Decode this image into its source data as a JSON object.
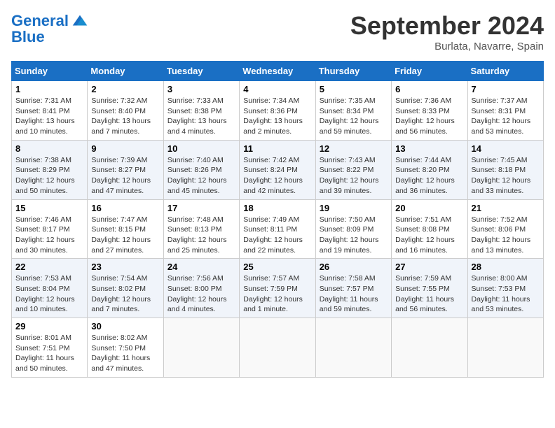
{
  "header": {
    "logo_line1": "General",
    "logo_line2": "Blue",
    "month_title": "September 2024",
    "location": "Burlata, Navarre, Spain"
  },
  "days_of_week": [
    "Sunday",
    "Monday",
    "Tuesday",
    "Wednesday",
    "Thursday",
    "Friday",
    "Saturday"
  ],
  "weeks": [
    [
      {
        "day": 1,
        "sunrise": "7:31 AM",
        "sunset": "8:41 PM",
        "daylight": "13 hours and 10 minutes."
      },
      {
        "day": 2,
        "sunrise": "7:32 AM",
        "sunset": "8:40 PM",
        "daylight": "13 hours and 7 minutes."
      },
      {
        "day": 3,
        "sunrise": "7:33 AM",
        "sunset": "8:38 PM",
        "daylight": "13 hours and 4 minutes."
      },
      {
        "day": 4,
        "sunrise": "7:34 AM",
        "sunset": "8:36 PM",
        "daylight": "13 hours and 2 minutes."
      },
      {
        "day": 5,
        "sunrise": "7:35 AM",
        "sunset": "8:34 PM",
        "daylight": "12 hours and 59 minutes."
      },
      {
        "day": 6,
        "sunrise": "7:36 AM",
        "sunset": "8:33 PM",
        "daylight": "12 hours and 56 minutes."
      },
      {
        "day": 7,
        "sunrise": "7:37 AM",
        "sunset": "8:31 PM",
        "daylight": "12 hours and 53 minutes."
      }
    ],
    [
      {
        "day": 8,
        "sunrise": "7:38 AM",
        "sunset": "8:29 PM",
        "daylight": "12 hours and 50 minutes."
      },
      {
        "day": 9,
        "sunrise": "7:39 AM",
        "sunset": "8:27 PM",
        "daylight": "12 hours and 47 minutes."
      },
      {
        "day": 10,
        "sunrise": "7:40 AM",
        "sunset": "8:26 PM",
        "daylight": "12 hours and 45 minutes."
      },
      {
        "day": 11,
        "sunrise": "7:42 AM",
        "sunset": "8:24 PM",
        "daylight": "12 hours and 42 minutes."
      },
      {
        "day": 12,
        "sunrise": "7:43 AM",
        "sunset": "8:22 PM",
        "daylight": "12 hours and 39 minutes."
      },
      {
        "day": 13,
        "sunrise": "7:44 AM",
        "sunset": "8:20 PM",
        "daylight": "12 hours and 36 minutes."
      },
      {
        "day": 14,
        "sunrise": "7:45 AM",
        "sunset": "8:18 PM",
        "daylight": "12 hours and 33 minutes."
      }
    ],
    [
      {
        "day": 15,
        "sunrise": "7:46 AM",
        "sunset": "8:17 PM",
        "daylight": "12 hours and 30 minutes."
      },
      {
        "day": 16,
        "sunrise": "7:47 AM",
        "sunset": "8:15 PM",
        "daylight": "12 hours and 27 minutes."
      },
      {
        "day": 17,
        "sunrise": "7:48 AM",
        "sunset": "8:13 PM",
        "daylight": "12 hours and 25 minutes."
      },
      {
        "day": 18,
        "sunrise": "7:49 AM",
        "sunset": "8:11 PM",
        "daylight": "12 hours and 22 minutes."
      },
      {
        "day": 19,
        "sunrise": "7:50 AM",
        "sunset": "8:09 PM",
        "daylight": "12 hours and 19 minutes."
      },
      {
        "day": 20,
        "sunrise": "7:51 AM",
        "sunset": "8:08 PM",
        "daylight": "12 hours and 16 minutes."
      },
      {
        "day": 21,
        "sunrise": "7:52 AM",
        "sunset": "8:06 PM",
        "daylight": "12 hours and 13 minutes."
      }
    ],
    [
      {
        "day": 22,
        "sunrise": "7:53 AM",
        "sunset": "8:04 PM",
        "daylight": "12 hours and 10 minutes."
      },
      {
        "day": 23,
        "sunrise": "7:54 AM",
        "sunset": "8:02 PM",
        "daylight": "12 hours and 7 minutes."
      },
      {
        "day": 24,
        "sunrise": "7:56 AM",
        "sunset": "8:00 PM",
        "daylight": "12 hours and 4 minutes."
      },
      {
        "day": 25,
        "sunrise": "7:57 AM",
        "sunset": "7:59 PM",
        "daylight": "12 hours and 1 minute."
      },
      {
        "day": 26,
        "sunrise": "7:58 AM",
        "sunset": "7:57 PM",
        "daylight": "11 hours and 59 minutes."
      },
      {
        "day": 27,
        "sunrise": "7:59 AM",
        "sunset": "7:55 PM",
        "daylight": "11 hours and 56 minutes."
      },
      {
        "day": 28,
        "sunrise": "8:00 AM",
        "sunset": "7:53 PM",
        "daylight": "11 hours and 53 minutes."
      }
    ],
    [
      {
        "day": 29,
        "sunrise": "8:01 AM",
        "sunset": "7:51 PM",
        "daylight": "11 hours and 50 minutes."
      },
      {
        "day": 30,
        "sunrise": "8:02 AM",
        "sunset": "7:50 PM",
        "daylight": "11 hours and 47 minutes."
      },
      null,
      null,
      null,
      null,
      null
    ]
  ]
}
